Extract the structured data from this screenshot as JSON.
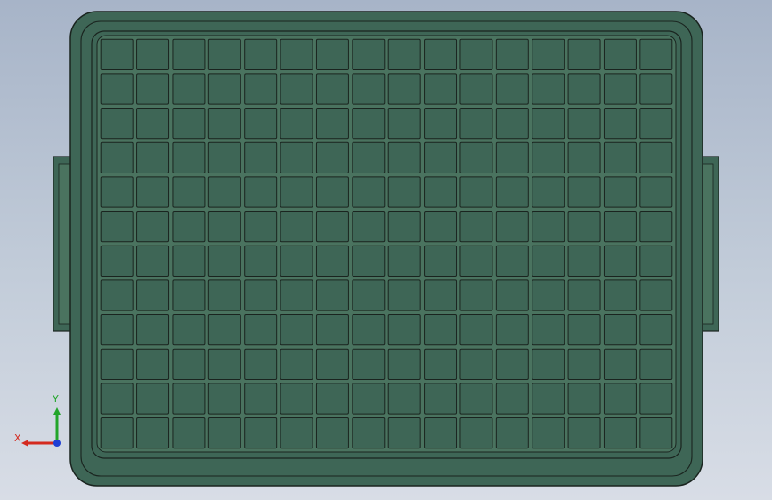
{
  "viewport": {
    "background_top": "#a7b4c8",
    "background_bottom": "#d8dde6"
  },
  "model": {
    "part": "tray",
    "view": "top",
    "body_color": "#3e6656",
    "body_light": "#4a735f",
    "edge_color": "#1a241f",
    "grid_rows": 12,
    "grid_cols": 16,
    "handles": [
      "left-handle",
      "right-handle"
    ]
  },
  "triad": {
    "x_label": "X",
    "y_label": "Y",
    "x_color": "#d42a1f",
    "y_color": "#22a52a",
    "z_color": "#1f3fd4"
  }
}
